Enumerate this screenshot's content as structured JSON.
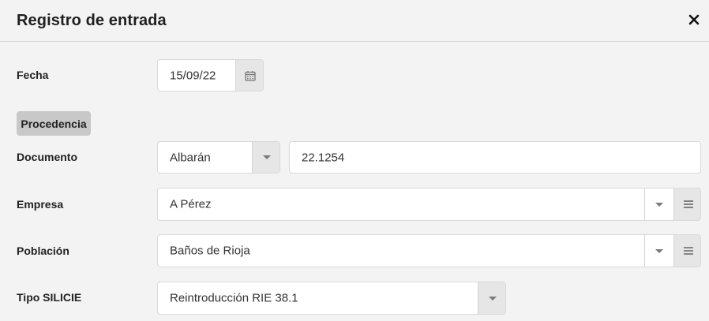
{
  "dialog": {
    "title": "Registro de entrada",
    "close_label": "✕"
  },
  "fields": {
    "fecha": {
      "label": "Fecha",
      "value": "15/09/22"
    },
    "section": {
      "label": "Procedencia"
    },
    "documento": {
      "label": "Documento",
      "type_value": "Albarán",
      "number_value": "22.1254"
    },
    "empresa": {
      "label": "Empresa",
      "value": "A Pérez"
    },
    "poblacion": {
      "label": "Población",
      "value": "Baños de Rioja"
    },
    "tipo_silicie": {
      "label": "Tipo SILICIE",
      "value": "Reintroducción RIE 38.1"
    }
  },
  "icons": {
    "calendar": "calendar-icon",
    "dropdown": "chevron-down-icon",
    "list": "list-icon",
    "close": "close-icon"
  },
  "colors": {
    "background": "#f3f3f3",
    "field_background": "#ffffff",
    "button_background": "#e6e6e6",
    "badge_background": "#c8c8c8"
  }
}
